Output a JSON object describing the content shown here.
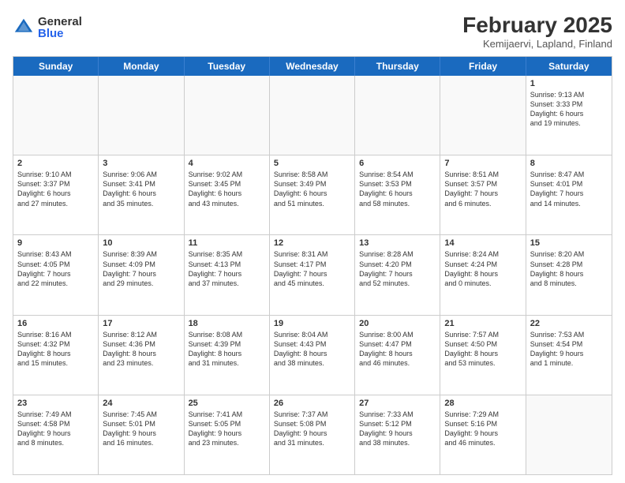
{
  "logo": {
    "general": "General",
    "blue": "Blue"
  },
  "title": "February 2025",
  "subtitle": "Kemijaervi, Lapland, Finland",
  "days": [
    "Sunday",
    "Monday",
    "Tuesday",
    "Wednesday",
    "Thursday",
    "Friday",
    "Saturday"
  ],
  "rows": [
    [
      {
        "day": "",
        "text": ""
      },
      {
        "day": "",
        "text": ""
      },
      {
        "day": "",
        "text": ""
      },
      {
        "day": "",
        "text": ""
      },
      {
        "day": "",
        "text": ""
      },
      {
        "day": "",
        "text": ""
      },
      {
        "day": "1",
        "text": "Sunrise: 9:13 AM\nSunset: 3:33 PM\nDaylight: 6 hours\nand 19 minutes."
      }
    ],
    [
      {
        "day": "2",
        "text": "Sunrise: 9:10 AM\nSunset: 3:37 PM\nDaylight: 6 hours\nand 27 minutes."
      },
      {
        "day": "3",
        "text": "Sunrise: 9:06 AM\nSunset: 3:41 PM\nDaylight: 6 hours\nand 35 minutes."
      },
      {
        "day": "4",
        "text": "Sunrise: 9:02 AM\nSunset: 3:45 PM\nDaylight: 6 hours\nand 43 minutes."
      },
      {
        "day": "5",
        "text": "Sunrise: 8:58 AM\nSunset: 3:49 PM\nDaylight: 6 hours\nand 51 minutes."
      },
      {
        "day": "6",
        "text": "Sunrise: 8:54 AM\nSunset: 3:53 PM\nDaylight: 6 hours\nand 58 minutes."
      },
      {
        "day": "7",
        "text": "Sunrise: 8:51 AM\nSunset: 3:57 PM\nDaylight: 7 hours\nand 6 minutes."
      },
      {
        "day": "8",
        "text": "Sunrise: 8:47 AM\nSunset: 4:01 PM\nDaylight: 7 hours\nand 14 minutes."
      }
    ],
    [
      {
        "day": "9",
        "text": "Sunrise: 8:43 AM\nSunset: 4:05 PM\nDaylight: 7 hours\nand 22 minutes."
      },
      {
        "day": "10",
        "text": "Sunrise: 8:39 AM\nSunset: 4:09 PM\nDaylight: 7 hours\nand 29 minutes."
      },
      {
        "day": "11",
        "text": "Sunrise: 8:35 AM\nSunset: 4:13 PM\nDaylight: 7 hours\nand 37 minutes."
      },
      {
        "day": "12",
        "text": "Sunrise: 8:31 AM\nSunset: 4:17 PM\nDaylight: 7 hours\nand 45 minutes."
      },
      {
        "day": "13",
        "text": "Sunrise: 8:28 AM\nSunset: 4:20 PM\nDaylight: 7 hours\nand 52 minutes."
      },
      {
        "day": "14",
        "text": "Sunrise: 8:24 AM\nSunset: 4:24 PM\nDaylight: 8 hours\nand 0 minutes."
      },
      {
        "day": "15",
        "text": "Sunrise: 8:20 AM\nSunset: 4:28 PM\nDaylight: 8 hours\nand 8 minutes."
      }
    ],
    [
      {
        "day": "16",
        "text": "Sunrise: 8:16 AM\nSunset: 4:32 PM\nDaylight: 8 hours\nand 15 minutes."
      },
      {
        "day": "17",
        "text": "Sunrise: 8:12 AM\nSunset: 4:36 PM\nDaylight: 8 hours\nand 23 minutes."
      },
      {
        "day": "18",
        "text": "Sunrise: 8:08 AM\nSunset: 4:39 PM\nDaylight: 8 hours\nand 31 minutes."
      },
      {
        "day": "19",
        "text": "Sunrise: 8:04 AM\nSunset: 4:43 PM\nDaylight: 8 hours\nand 38 minutes."
      },
      {
        "day": "20",
        "text": "Sunrise: 8:00 AM\nSunset: 4:47 PM\nDaylight: 8 hours\nand 46 minutes."
      },
      {
        "day": "21",
        "text": "Sunrise: 7:57 AM\nSunset: 4:50 PM\nDaylight: 8 hours\nand 53 minutes."
      },
      {
        "day": "22",
        "text": "Sunrise: 7:53 AM\nSunset: 4:54 PM\nDaylight: 9 hours\nand 1 minute."
      }
    ],
    [
      {
        "day": "23",
        "text": "Sunrise: 7:49 AM\nSunset: 4:58 PM\nDaylight: 9 hours\nand 8 minutes."
      },
      {
        "day": "24",
        "text": "Sunrise: 7:45 AM\nSunset: 5:01 PM\nDaylight: 9 hours\nand 16 minutes."
      },
      {
        "day": "25",
        "text": "Sunrise: 7:41 AM\nSunset: 5:05 PM\nDaylight: 9 hours\nand 23 minutes."
      },
      {
        "day": "26",
        "text": "Sunrise: 7:37 AM\nSunset: 5:08 PM\nDaylight: 9 hours\nand 31 minutes."
      },
      {
        "day": "27",
        "text": "Sunrise: 7:33 AM\nSunset: 5:12 PM\nDaylight: 9 hours\nand 38 minutes."
      },
      {
        "day": "28",
        "text": "Sunrise: 7:29 AM\nSunset: 5:16 PM\nDaylight: 9 hours\nand 46 minutes."
      },
      {
        "day": "",
        "text": ""
      }
    ]
  ]
}
